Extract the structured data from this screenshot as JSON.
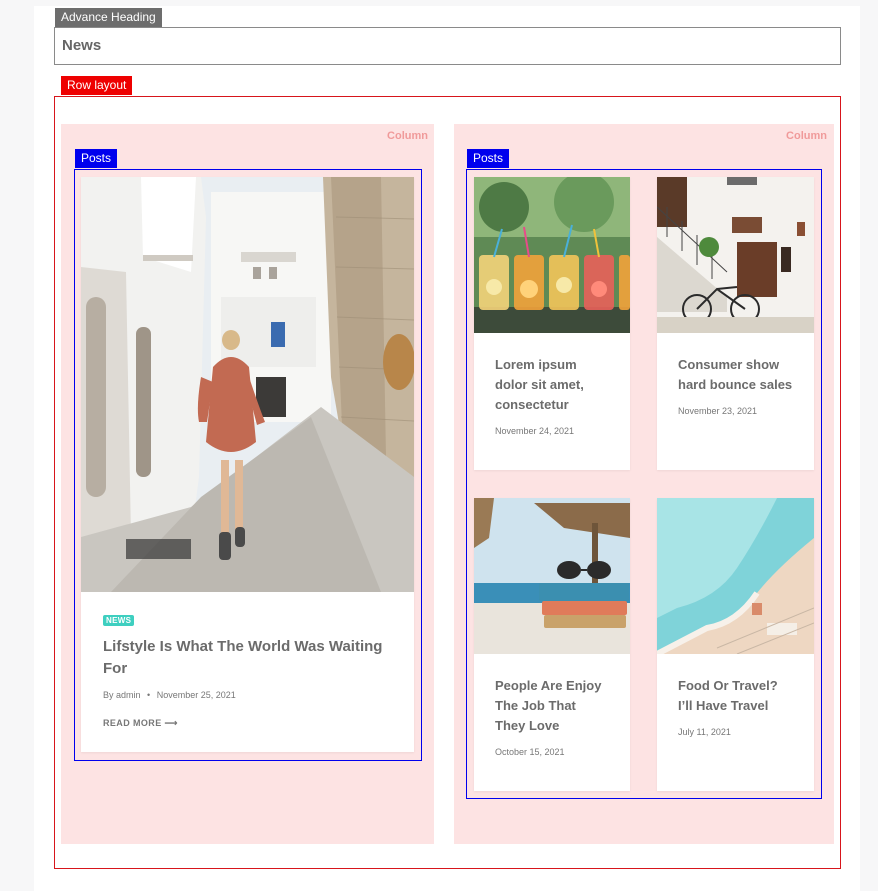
{
  "heading_tag": "Advance Heading",
  "heading_text": "News",
  "row_tag": "Row layout",
  "column_label": "Column",
  "posts_tag": "Posts",
  "featured": {
    "badge": "NEWS",
    "title_line1": "Lifstyle Is What The World Was Waiting",
    "title_line2": "For",
    "author": "By admin",
    "separator": "•",
    "date": "November 25, 2021",
    "read_more": "READ MORE ⟶"
  },
  "posts": [
    {
      "title_lines": [
        "Lorem ipsum",
        "dolor sit amet,",
        "consectetur"
      ],
      "date": "November 24, 2021"
    },
    {
      "title_lines": [
        "Consumer show",
        "hard bounce sales"
      ],
      "date": "November 23, 2021"
    },
    {
      "title_lines": [
        "People Are Enjoy",
        "The Job That",
        "They Love"
      ],
      "date": "October 15, 2021"
    },
    {
      "title_lines": [
        "Food Or Travel?",
        "I’ll Have Travel"
      ],
      "date": "July 11, 2021"
    }
  ],
  "colors": {
    "accent_red": "#ee0000",
    "accent_blue": "#0000ee",
    "column_bg": "#fde3e3",
    "badge": "#3ecfc0"
  }
}
